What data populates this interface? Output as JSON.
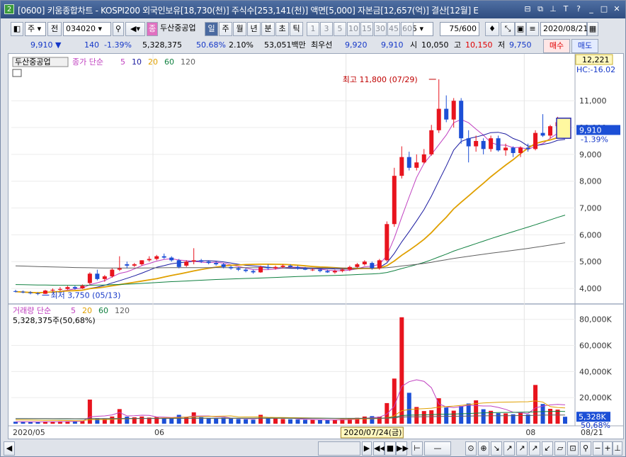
{
  "window": {
    "num": "2",
    "title": "[0600] 키움종합차트 - KOSPI200 외국인보유[18,730(천)] 주식수[253,141(천)] 액면[5,000] 자본금[12,657(억)] 결산[12월] E"
  },
  "toolbar": {
    "market": "주",
    "jeon": "전",
    "code": "034020",
    "badge": "종",
    "stock_name": "두산중공업",
    "periods": [
      "일",
      "주",
      "월",
      "년",
      "분",
      "초",
      "틱"
    ],
    "minutes": [
      "1",
      "3",
      "5",
      "10",
      "15",
      "30",
      "45",
      "60"
    ],
    "minute_sel": "5",
    "count": "75/600",
    "date": "2020/08/21"
  },
  "quote": {
    "price": "9,910",
    "change": "140",
    "pct": "-1.39%",
    "volume": "5,328,375",
    "vol_ratio": "50.68%",
    "turnover": "2.10%",
    "amount": "53,051백만",
    "priority": "최우선",
    "ask": "9,920",
    "bid": "9,910",
    "open_lbl": "시",
    "open": "10,050",
    "high_lbl": "고",
    "high": "10,150",
    "low_lbl": "저",
    "low": "9,750",
    "buy": "매수",
    "sell": "매도"
  },
  "price_panel": {
    "name": "두산중공업",
    "legend_prefix": "종가 단순",
    "ma_labels": [
      "5",
      "10",
      "20",
      "60",
      "120"
    ],
    "max_label": "최고 11,800 (07/29)",
    "min_label": "최저 3,750 (05/13)",
    "top_value": "12,221",
    "hc_label": "HC:-16.02",
    "cur_price": "9,910",
    "cur_pct": "-1.39%",
    "yticks": [
      "11,000",
      "10,000",
      "9,000",
      "8,000",
      "7,000",
      "6,000",
      "5,000",
      "4,000"
    ]
  },
  "volume_panel": {
    "legend_prefix": "거래량 단순",
    "ma_labels": [
      "5",
      "20",
      "60",
      "120"
    ],
    "cur_label": "5,328,375주(50,68%)",
    "yticks": [
      "80,000K",
      "60,000K",
      "40,000K",
      "20,000K"
    ],
    "cur_volume": "5,328K",
    "cur_pct": "50,68%"
  },
  "xaxis": {
    "labels": [
      "2020/05",
      "06",
      "07",
      "08"
    ],
    "crosshair_date": "2020/07/24(금)",
    "end_date": "08/21"
  },
  "colors": {
    "up": "#e8141e",
    "down": "#1c4fd6",
    "ma5": "#c040c0",
    "ma10": "#1a1aa0",
    "ma20": "#e0a000",
    "ma60": "#108040",
    "ma120": "#606060"
  },
  "chart_data": {
    "type": "candlestick",
    "x_labels": [
      "2020/05",
      "06",
      "07",
      "08"
    ],
    "ohlc": [
      [
        3900,
        3950,
        3850,
        3880
      ],
      [
        3880,
        3920,
        3820,
        3850
      ],
      [
        3850,
        3900,
        3780,
        3820
      ],
      [
        3820,
        3860,
        3750,
        3800
      ],
      [
        3800,
        3950,
        3790,
        3920
      ],
      [
        3920,
        4000,
        3880,
        3950
      ],
      [
        3950,
        4050,
        3900,
        3980
      ],
      [
        3980,
        4100,
        3950,
        4050
      ],
      [
        4050,
        4100,
        3950,
        4000
      ],
      [
        4000,
        4150,
        3980,
        4100
      ],
      [
        4200,
        4600,
        4150,
        4550
      ],
      [
        4550,
        4700,
        4300,
        4350
      ],
      [
        4350,
        4500,
        4250,
        4450
      ],
      [
        4450,
        4750,
        4400,
        4700
      ],
      [
        4700,
        5200,
        4650,
        4750
      ],
      [
        4900,
        5000,
        4750,
        4850
      ],
      [
        4850,
        4950,
        4800,
        4900
      ],
      [
        4900,
        5050,
        4850,
        5050
      ],
      [
        5050,
        5200,
        5000,
        5100
      ],
      [
        5100,
        5250,
        5050,
        5200
      ],
      [
        5200,
        5300,
        5100,
        5150
      ],
      [
        5150,
        5200,
        5000,
        5050
      ],
      [
        5050,
        5100,
        4750,
        4800
      ],
      [
        4850,
        5050,
        4800,
        5000
      ],
      [
        5000,
        5500,
        4900,
        5050
      ],
      [
        5050,
        5100,
        4950,
        5000
      ],
      [
        5000,
        5050,
        4900,
        4950
      ],
      [
        4950,
        5000,
        4850,
        4900
      ],
      [
        4900,
        4950,
        4750,
        4800
      ],
      [
        4800,
        4850,
        4700,
        4750
      ],
      [
        4750,
        4800,
        4650,
        4700
      ],
      [
        4700,
        4750,
        4600,
        4650
      ],
      [
        4650,
        4700,
        4550,
        4600
      ],
      [
        4600,
        4850,
        4580,
        4800
      ],
      [
        4800,
        4900,
        4700,
        4750
      ],
      [
        4750,
        4850,
        4700,
        4800
      ],
      [
        4800,
        4900,
        4750,
        4850
      ],
      [
        4850,
        4900,
        4750,
        4800
      ],
      [
        4800,
        4850,
        4700,
        4750
      ],
      [
        4750,
        4800,
        4680,
        4700
      ],
      [
        4700,
        4750,
        4650,
        4700
      ],
      [
        4700,
        4750,
        4600,
        4650
      ],
      [
        4650,
        4700,
        4580,
        4600
      ],
      [
        4600,
        4700,
        4550,
        4650
      ],
      [
        4650,
        4750,
        4600,
        4700
      ],
      [
        4700,
        4850,
        4650,
        4800
      ],
      [
        4800,
        4950,
        4750,
        4900
      ],
      [
        4900,
        5050,
        4850,
        5000
      ],
      [
        4950,
        5000,
        4700,
        4750
      ],
      [
        4750,
        5100,
        4700,
        5050
      ],
      [
        5050,
        6500,
        5000,
        6400
      ],
      [
        6400,
        8500,
        6300,
        8200
      ],
      [
        8200,
        9300,
        8100,
        8900
      ],
      [
        8900,
        9100,
        8400,
        8500
      ],
      [
        8500,
        9000,
        8400,
        8700
      ],
      [
        8700,
        9200,
        8650,
        9000
      ],
      [
        9000,
        10100,
        8950,
        9900
      ],
      [
        9900,
        11800,
        9800,
        10700
      ],
      [
        10700,
        11200,
        10200,
        10300
      ],
      [
        10300,
        11100,
        10000,
        11000
      ],
      [
        11000,
        11100,
        9400,
        9600
      ],
      [
        9600,
        9900,
        8700,
        9300
      ],
      [
        9300,
        9700,
        9100,
        9500
      ],
      [
        9500,
        9600,
        9000,
        9200
      ],
      [
        9200,
        9700,
        9100,
        9600
      ],
      [
        9600,
        9700,
        9100,
        9150
      ],
      [
        9150,
        9400,
        8950,
        9250
      ],
      [
        9250,
        9300,
        8900,
        9050
      ],
      [
        9050,
        9300,
        8900,
        9250
      ],
      [
        9250,
        9400,
        9100,
        9200
      ],
      [
        9200,
        9900,
        9150,
        9800
      ],
      [
        9800,
        10500,
        9650,
        9700
      ],
      [
        9700,
        10100,
        9600,
        10050
      ],
      [
        10050,
        10400,
        9950,
        10200
      ],
      [
        10050,
        10150,
        9750,
        9910
      ]
    ],
    "volume_k": [
      1500,
      1400,
      1300,
      1200,
      1700,
      1600,
      1800,
      1900,
      1700,
      2100,
      18500,
      4200,
      3500,
      5500,
      11200,
      5400,
      4900,
      5500,
      4700,
      5200,
      4600,
      3900,
      6800,
      5100,
      8700,
      5000,
      4100,
      3900,
      4700,
      3800,
      3600,
      3400,
      3100,
      6800,
      4200,
      3900,
      3600,
      3400,
      3200,
      3000,
      2900,
      2800,
      2700,
      3100,
      3400,
      3800,
      4500,
      5500,
      5800,
      5400,
      15800,
      34600,
      81600,
      23700,
      12800,
      9700,
      10300,
      19500,
      12400,
      10000,
      13500,
      15500,
      17900,
      11100,
      9900,
      8100,
      7900,
      7200,
      8600,
      7100,
      29700,
      15100,
      11400,
      10800,
      5328
    ]
  }
}
